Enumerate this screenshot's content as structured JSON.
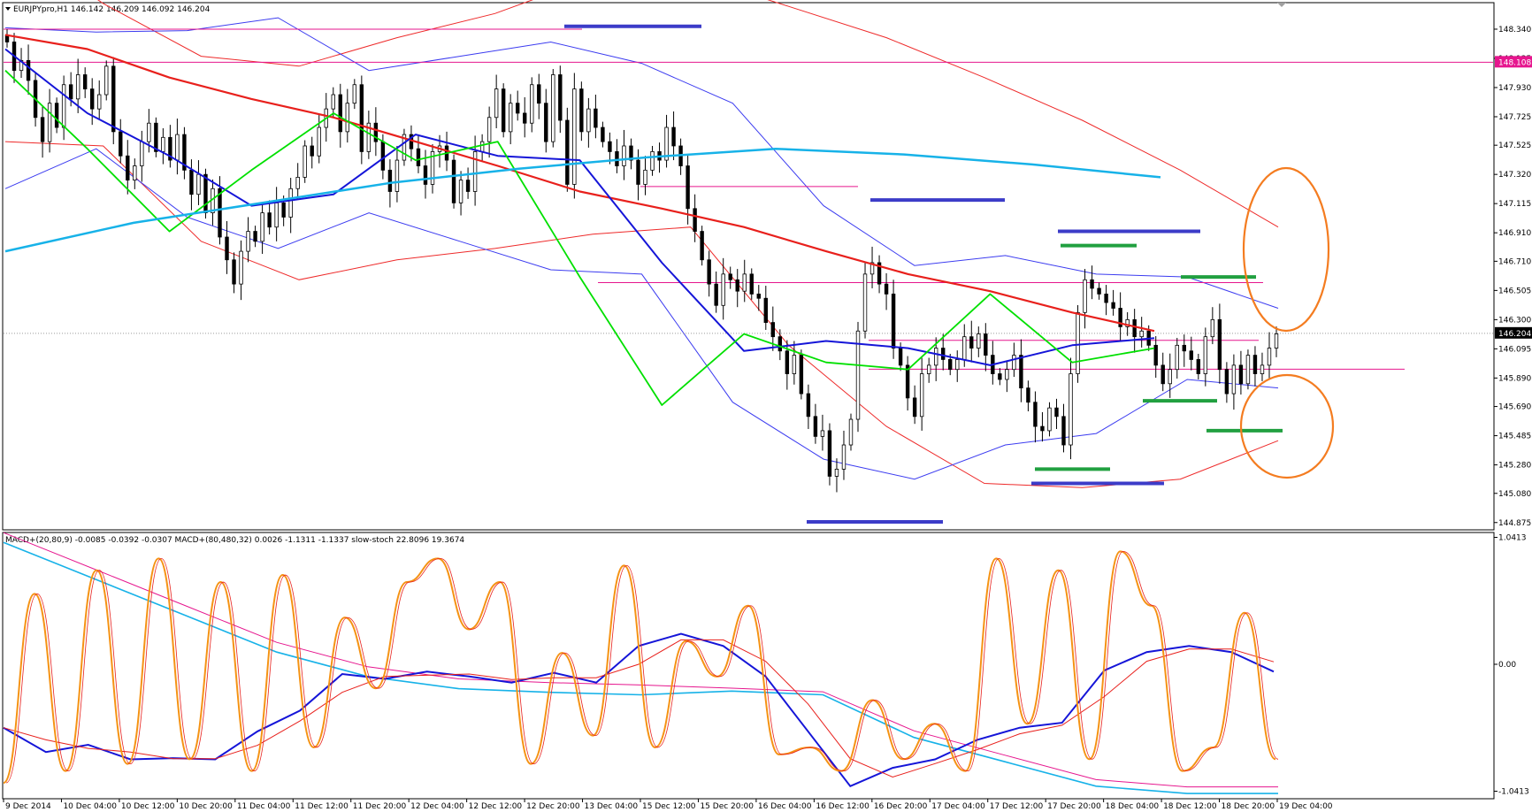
{
  "window": {
    "title": "EURJPYpro,H1",
    "ohlc": "146.142 146.209 146.092 146.204",
    "sub_indicators": "MACD+(20,80,9) -0.0085 -0.0392 -0.0307  MACD+(80,480,32) 0.0026 -1.1311 -1.1337  slow-stoch 22.8096 19.3674"
  },
  "colors": {
    "background": "#ffffff",
    "bull": "#ffffff",
    "bear": "#000000",
    "ma_red": "#e8201c",
    "ma_blue": "#1515d8",
    "ma_green": "#00e000",
    "ma_cyan": "#17b2e8",
    "bands": "#3c3cf0",
    "envelope": "#ee2a2a",
    "level": "#e6168e",
    "res_bar": "#3c3cc8",
    "sup_bar": "#21a040",
    "circle": "#f47c20",
    "stoch": "#f59314",
    "macd_main": "#1515d8",
    "macd_signal": "#e8201c",
    "macd_slow_main": "#17b2e8",
    "macd_slow_signal": "#e6168e"
  },
  "chart_data": {
    "type": "candlestick",
    "symbol": "EURJPYpro",
    "timeframe": "H1",
    "price_axis": {
      "range": [
        144.83,
        148.52
      ],
      "ticks": [
        "148.340",
        "148.135",
        "147.930",
        "147.725",
        "147.525",
        "147.320",
        "147.115",
        "146.910",
        "146.710",
        "146.505",
        "146.300",
        "146.095",
        "145.890",
        "145.690",
        "145.485",
        "145.280",
        "145.080",
        "144.875"
      ],
      "current": "146.204",
      "marked_level": "148.108"
    },
    "time_axis": {
      "labels": [
        "9 Dec 2014",
        "10 Dec 04:00",
        "10 Dec 12:00",
        "10 Dec 20:00",
        "11 Dec 04:00",
        "11 Dec 12:00",
        "11 Dec 20:00",
        "12 Dec 04:00",
        "12 Dec 12:00",
        "12 Dec 20:00",
        "13 Dec 04:00",
        "15 Dec 12:00",
        "15 Dec 20:00",
        "16 Dec 04:00",
        "16 Dec 12:00",
        "16 Dec 20:00",
        "17 Dec 04:00",
        "17 Dec 12:00",
        "17 Dec 20:00",
        "18 Dec 04:00",
        "18 Dec 12:00",
        "18 Dec 20:00",
        "19 Dec 04:00"
      ]
    },
    "candles_close": [
      148.25,
      148.05,
      148.12,
      147.98,
      147.72,
      147.55,
      147.82,
      147.65,
      147.95,
      147.85,
      148.02,
      147.92,
      147.78,
      147.88,
      148.08,
      147.62,
      147.45,
      147.28,
      147.38,
      147.55,
      147.68,
      147.48,
      147.58,
      147.42,
      147.6,
      147.35,
      147.18,
      147.32,
      147.05,
      147.22,
      146.88,
      146.72,
      146.55,
      146.78,
      146.92,
      146.85,
      147.05,
      146.95,
      147.12,
      147.02,
      147.22,
      147.3,
      147.52,
      147.45,
      147.65,
      147.78,
      147.88,
      147.62,
      147.82,
      147.95,
      147.48,
      147.68,
      147.55,
      147.35,
      147.2,
      147.42,
      147.6,
      147.5,
      147.38,
      147.25,
      147.48,
      147.52,
      147.42,
      147.12,
      147.28,
      147.2,
      147.48,
      147.55,
      147.72,
      147.92,
      147.62,
      147.82,
      147.75,
      147.68,
      147.95,
      147.82,
      147.55,
      148.02,
      147.7,
      147.25,
      147.92,
      147.62,
      147.78,
      147.65,
      147.55,
      147.48,
      147.38,
      147.52,
      147.42,
      147.25,
      147.35,
      147.48,
      147.42,
      147.65,
      147.52,
      147.38,
      147.08,
      146.92,
      146.72,
      146.55,
      146.4,
      146.62,
      146.58,
      146.5,
      146.62,
      146.48,
      146.45,
      146.28,
      146.18,
      146.08,
      145.92,
      146.05,
      145.78,
      145.62,
      145.48,
      145.52,
      145.2,
      145.25,
      145.42,
      145.6,
      146.22,
      146.62,
      146.7,
      146.55,
      146.48,
      146.1,
      145.98,
      145.75,
      145.62,
      145.92,
      145.98,
      146.1,
      146.02,
      145.95,
      146.02,
      146.18,
      146.1,
      146.2,
      146.05,
      145.92,
      145.88,
      145.95,
      146.05,
      145.82,
      145.72,
      145.55,
      145.52,
      145.68,
      145.62,
      145.42,
      145.92,
      146.35,
      146.58,
      146.52,
      146.48,
      146.42,
      146.38,
      146.25,
      146.3,
      146.18,
      146.22,
      146.12,
      145.98,
      145.85,
      145.95,
      146.12,
      146.08,
      146.02,
      145.92,
      146.18,
      146.3,
      145.95,
      145.78,
      145.98,
      145.85,
      146.05,
      145.92,
      145.98,
      146.1,
      146.2
    ],
    "moving_averages": [
      {
        "color": "red",
        "values": [
          148.3,
          148.2,
          148.0,
          147.85,
          147.72,
          147.55,
          147.38,
          147.2,
          147.08,
          146.95,
          146.78,
          146.62,
          146.5,
          146.35,
          146.22
        ]
      },
      {
        "color": "blue",
        "values": [
          148.2,
          147.75,
          147.45,
          147.1,
          147.18,
          147.6,
          147.45,
          147.42,
          146.7,
          146.08,
          146.15,
          146.1,
          145.98,
          146.12,
          146.17
        ]
      },
      {
        "color": "green",
        "values": [
          148.05,
          147.5,
          146.92,
          147.35,
          147.75,
          147.42,
          147.55,
          146.6,
          145.7,
          146.2,
          146.0,
          145.95,
          146.48,
          146.0,
          146.1
        ]
      },
      {
        "color": "cyan",
        "values": [
          146.78,
          146.98,
          147.12,
          147.26,
          147.36,
          147.44,
          147.5,
          147.46,
          147.39,
          147.3
        ]
      }
    ],
    "horizontal_levels": [
      "148.340",
      "148.108",
      "147.235",
      "146.560",
      "146.155",
      "145.952"
    ],
    "bollinger_upper": [
      148.35,
      148.32,
      148.33,
      148.42,
      148.05,
      148.15,
      148.25,
      148.1,
      147.82,
      147.1,
      146.68,
      146.75,
      146.62,
      146.6,
      146.38
    ],
    "bollinger_lower": [
      147.22,
      147.5,
      147.02,
      146.8,
      147.05,
      146.85,
      146.65,
      146.62,
      145.72,
      145.32,
      145.18,
      145.42,
      145.5,
      145.88,
      145.82
    ],
    "envelope_upper": [
      149.0,
      148.52,
      148.15,
      148.08,
      148.28,
      148.45,
      148.7,
      148.72,
      148.5,
      148.28,
      148.0,
      147.7,
      147.35,
      146.95
    ],
    "envelope_lower": [
      147.55,
      147.52,
      146.85,
      146.58,
      146.72,
      146.8,
      146.9,
      146.95,
      146.12,
      145.55,
      145.15,
      145.12,
      145.18,
      145.45
    ]
  },
  "oscillator": {
    "axis": {
      "ticks": [
        "1.0413",
        "0.00",
        "-1.0413"
      ]
    },
    "stochastic_points": [
      0,
      0.8,
      0.05,
      0.9,
      0.08,
      0.95,
      0.1,
      0.85,
      0.05,
      0.88,
      0.15,
      0.7,
      0.4,
      0.85,
      0.95,
      0.65,
      0.85,
      0.08,
      0.55,
      0.2,
      0.92,
      0.15,
      0.6,
      0.45,
      0.75,
      0.12,
      0.15,
      0.05,
      0.35,
      0.1,
      0.25,
      0.05,
      0.95,
      0.25,
      0.9,
      0.1,
      0.98,
      0.75,
      0.05,
      0.15,
      0.72,
      0.1
    ],
    "macd_fast_values": [
      -0.52,
      -0.72,
      -0.66,
      -0.78,
      -0.77,
      -0.78,
      -0.55,
      -0.38,
      -0.08,
      -0.12,
      -0.06,
      -0.1,
      -0.15,
      -0.07,
      -0.15,
      0.15,
      0.25,
      0.15,
      -0.1,
      -0.55,
      -1.0,
      -0.85,
      -0.78,
      -0.62,
      -0.52,
      -0.48,
      -0.05,
      0.1,
      0.15,
      0.1,
      -0.06
    ],
    "macd_slow_values": [
      1.0,
      0.7,
      0.4,
      0.1,
      -0.1,
      -0.2,
      -0.23,
      -0.25,
      -0.22,
      -0.25,
      -0.6,
      -0.8,
      -1.0,
      -1.06,
      -1.06
    ]
  }
}
